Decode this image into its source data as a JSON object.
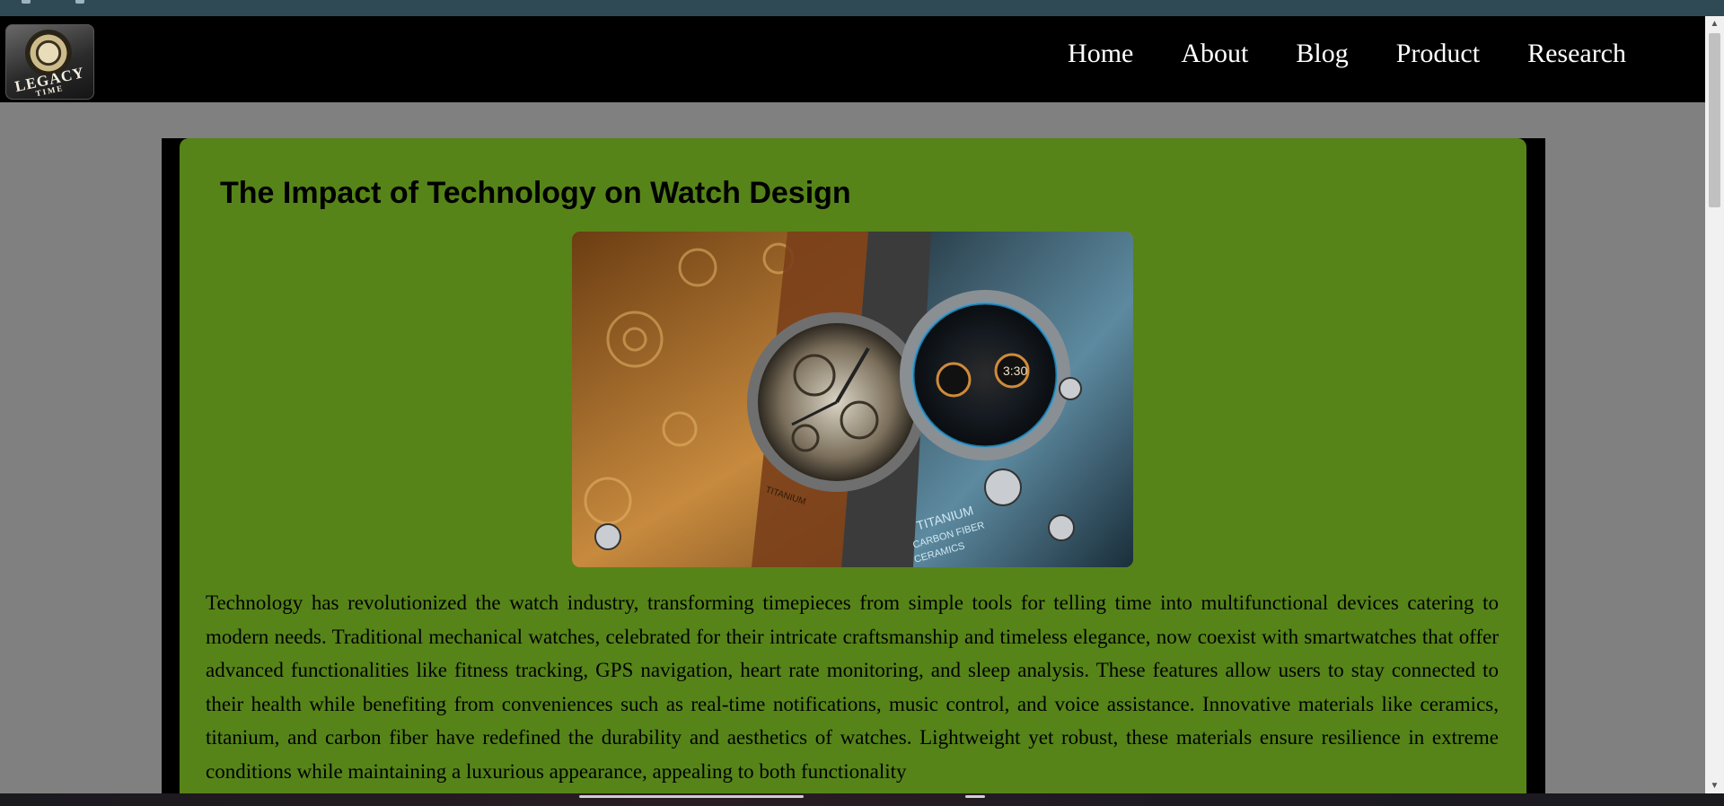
{
  "logo": {
    "line1": "LEGACY",
    "line2": "TIME"
  },
  "nav": {
    "items": [
      "Home",
      "About",
      "Blog",
      "Product",
      "Research"
    ]
  },
  "article": {
    "title": "The Impact of Technology on Watch Design",
    "image_captions": {
      "left_watch": "TITANIUM",
      "right_watch": [
        "TITANIUM",
        "CARBON FIBER",
        "CERAMICS"
      ]
    },
    "body": "Technology has revolutionized the watch industry, transforming timepieces from simple tools for telling time into multifunctional devices catering to modern needs. Traditional mechanical watches, celebrated for their intricate craftsmanship and timeless elegance, now coexist with smartwatches that offer advanced functionalities like fitness tracking, GPS navigation, heart rate monitoring, and sleep analysis. These features allow users to stay connected to their health while benefiting from conveniences such as real-time notifications, music control, and voice assistance. Innovative materials like ceramics, titanium, and carbon fiber have redefined the durability and aesthetics of watches. Lightweight yet robust, these materials ensure resilience in extreme conditions while maintaining a luxurious appearance, appealing to both functionality"
  },
  "colors": {
    "navbar": "#000000",
    "page_background": "#808080",
    "article_background": "#568419",
    "article_frame": "#000000"
  }
}
